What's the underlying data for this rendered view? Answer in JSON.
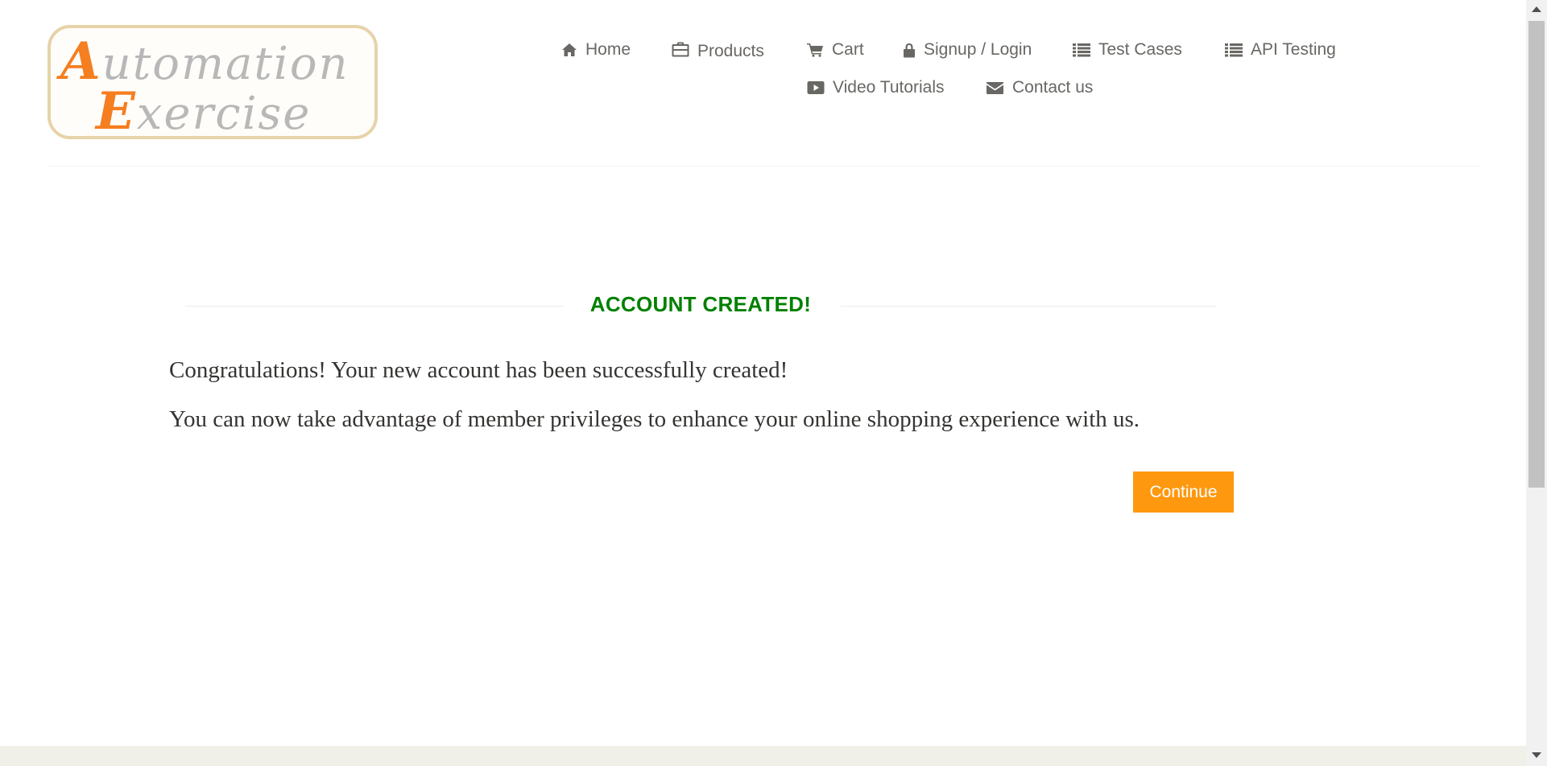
{
  "logo": {
    "line1_cap": "A",
    "line1_rest": "utomation",
    "line2_cap": "E",
    "line2_rest": "xercise"
  },
  "nav": {
    "items": [
      {
        "label": "Home",
        "icon": "home-icon"
      },
      {
        "label": "Products",
        "icon": "briefcase-icon"
      },
      {
        "label": "Cart",
        "icon": "cart-icon"
      },
      {
        "label": "Signup / Login",
        "icon": "lock-icon"
      },
      {
        "label": "Test Cases",
        "icon": "list-icon"
      },
      {
        "label": "API Testing",
        "icon": "list-icon"
      },
      {
        "label": "Video Tutorials",
        "icon": "youtube-play-icon"
      },
      {
        "label": "Contact us",
        "icon": "envelope-icon"
      }
    ]
  },
  "main": {
    "title": "ACCOUNT CREATED!",
    "paragraph1": "Congratulations! Your new account has been successfully created!",
    "paragraph2": "You can now take advantage of member privileges to enhance your online shopping experience with us.",
    "continue_label": "Continue"
  },
  "colors": {
    "title_green": "#008000",
    "button_orange": "#fe980f",
    "nav_text": "#696763",
    "logo_orange": "#f57e20"
  }
}
